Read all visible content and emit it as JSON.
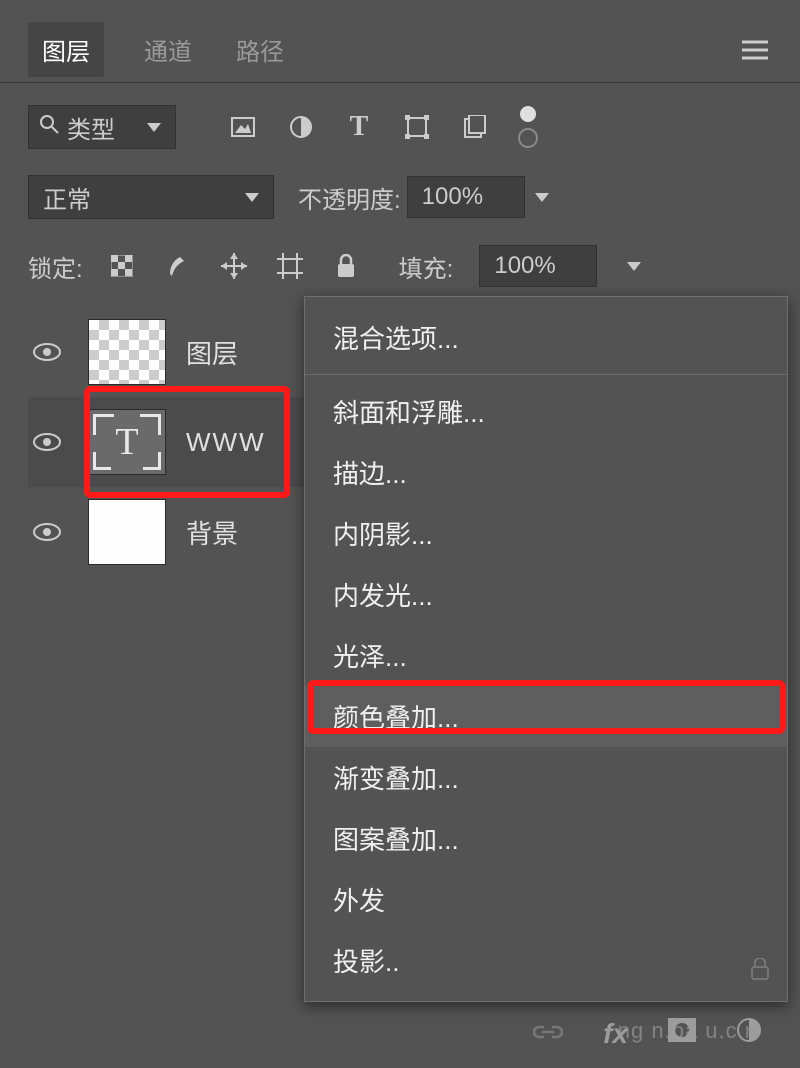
{
  "tabs": {
    "layers": "图层",
    "channels": "通道",
    "paths": "路径"
  },
  "filter": {
    "label": "类型"
  },
  "blend": {
    "mode": "正常",
    "opacityLabel": "不透明度:",
    "opacity": "100%"
  },
  "lock": {
    "label": "锁定:",
    "fillLabel": "填充:",
    "fill": "100%"
  },
  "layers": {
    "l1": "图层",
    "l2": "WWW",
    "l3": "背景"
  },
  "menu": {
    "blendingOptions": "混合选项...",
    "bevel": "斜面和浮雕...",
    "stroke": "描边...",
    "innerShadow": "内阴影...",
    "innerGlow": "内发光...",
    "satin": "光泽...",
    "colorOverlay": "颜色叠加...",
    "gradientOverlay": "渐变叠加...",
    "patternOverlay": "图案叠加...",
    "outerGlow": "外发",
    "dropShadow": "投影.."
  },
  "watermark": "ng   n.ba   u.c   n"
}
